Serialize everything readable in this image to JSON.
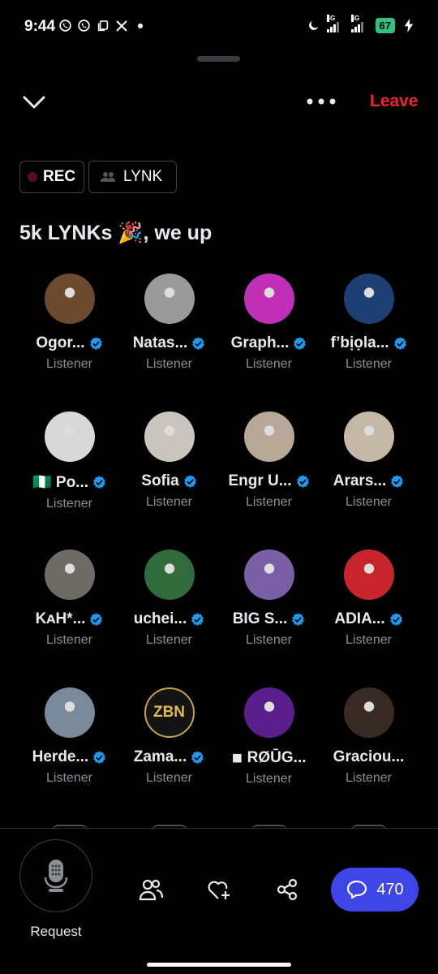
{
  "status_bar": {
    "time": "9:44",
    "left_icons": [
      "whatsapp-icon",
      "whatsapp-icon",
      "copy-icon",
      "x-logo-icon",
      "dot-icon"
    ],
    "network_1": "4G",
    "network_2": "4G",
    "battery": "67"
  },
  "top_bar": {
    "leave_label": "Leave"
  },
  "chips": {
    "rec_label": "REC",
    "lynk_label": "LYNK"
  },
  "space": {
    "title": "5k LYNKs 🎉, we up"
  },
  "speakers": [
    {
      "name": "Ogor...",
      "role": "Listener",
      "verified": true,
      "avatar_color": "#6b4a2e"
    },
    {
      "name": "Natas...",
      "role": "Listener",
      "verified": true,
      "avatar_color": "#9a9a9a"
    },
    {
      "name": "Graph...",
      "role": "Listener",
      "verified": true,
      "avatar_color": "#c02fb6"
    },
    {
      "name": "f’bịọla...",
      "role": "Listener",
      "verified": true,
      "avatar_color": "#1d3f73"
    },
    {
      "name": "🇳🇬 Po...",
      "role": "Listener",
      "verified": true,
      "avatar_color": "#d8d8d8"
    },
    {
      "name": "Sofia",
      "role": "Listener",
      "verified": true,
      "avatar_color": "#c9c4be"
    },
    {
      "name": "Engr U...",
      "role": "Listener",
      "verified": true,
      "avatar_color": "#b7a898"
    },
    {
      "name": "Arars...",
      "role": "Listener",
      "verified": true,
      "avatar_color": "#c6b8a6"
    },
    {
      "name": "KᴀH*...",
      "role": "Listener",
      "verified": true,
      "avatar_color": "#6e6a66"
    },
    {
      "name": "uchei...",
      "role": "Listener",
      "verified": true,
      "avatar_color": "#2f6b3b"
    },
    {
      "name": "BIG S...",
      "role": "Listener",
      "verified": true,
      "avatar_color": "#7a5ea6"
    },
    {
      "name": "ADIA...",
      "role": "Listener",
      "verified": true,
      "avatar_color": "#c8242b"
    },
    {
      "name": "Herde...",
      "role": "Listener",
      "verified": true,
      "avatar_color": "#7b8a9a"
    },
    {
      "name": "Zama...",
      "role": "Listener",
      "verified": true,
      "avatar_color": "#141414",
      "initials": "ZBN"
    },
    {
      "name": "◾ RØŪG...",
      "role": "Listener",
      "verified": false,
      "avatar_color": "#5a1e8c"
    },
    {
      "name": "Graciou...",
      "role": "Listener",
      "verified": false,
      "avatar_color": "#3a2a24"
    }
  ],
  "bottom_bar": {
    "request_label": "Request",
    "comments_count": "470"
  },
  "colors": {
    "accent_red": "#f4212e",
    "verified_blue": "#1d9bf0",
    "comments_button": "#3f46e8",
    "battery_green": "#2ec27e"
  }
}
